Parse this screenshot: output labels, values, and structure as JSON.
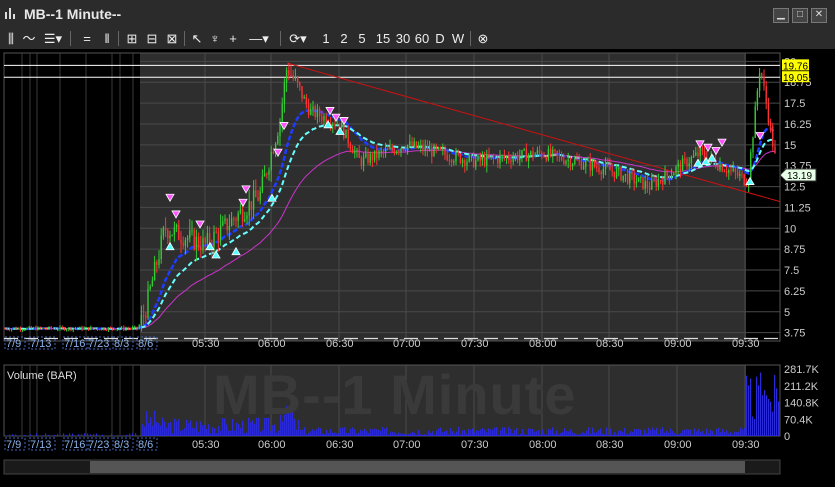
{
  "window": {
    "title": "MB--1 Minute--",
    "minimize": "▁",
    "restore": "□",
    "close": "✕"
  },
  "toolbar": {
    "intervals": [
      "1",
      "2",
      "5",
      "15",
      "30",
      "60",
      "D",
      "W"
    ]
  },
  "chart": {
    "watermark": "MB--1 Minute",
    "volume_label": "Volume (BAR)",
    "price_badges": {
      "upper_top": "19.76",
      "upper_bottom": "19.05",
      "last": "13.19"
    },
    "colors": {
      "up": "#33cc33",
      "down": "#ff3333",
      "ema_fast": "#1e3cff",
      "ema_slow": "#66ffff",
      "vwap": "#cc33cc",
      "trend": "#cc1111",
      "volume": "#2a2ad8",
      "badge_yellow": "#ffff00",
      "badge_last": "#e8ffe8"
    },
    "dates": [
      "7/9",
      "7/13",
      "7/16",
      "7/23",
      "8/3",
      "8/6"
    ]
  },
  "chart_data": {
    "type": "candlestick",
    "title": "MB--1 Minute",
    "x_ticks": [
      "05:30",
      "06:00",
      "06:30",
      "07:00",
      "07:30",
      "08:00",
      "08:30",
      "09:00",
      "09:30"
    ],
    "y_ticks": [
      3.75,
      5,
      6.25,
      7.5,
      8.75,
      10,
      11.25,
      12.5,
      13.75,
      15,
      16.25,
      17.5,
      18.75,
      20
    ],
    "ylim": [
      3.25,
      20.5
    ],
    "volume_ticks": [
      "0",
      "70.4K",
      "140.8K",
      "211.2K",
      "281.7K"
    ],
    "approx_price_path": [
      {
        "t": "pre-market",
        "price": 4.0
      },
      {
        "t": "05:00",
        "price": 5.0
      },
      {
        "t": "05:10",
        "price": 10.0
      },
      {
        "t": "05:30",
        "price": 9.0
      },
      {
        "t": "05:50",
        "price": 12.0
      },
      {
        "t": "06:00",
        "price": 16.5
      },
      {
        "t": "06:05",
        "price": 19.7
      },
      {
        "t": "06:15",
        "price": 17.0
      },
      {
        "t": "06:30",
        "price": 16.3
      },
      {
        "t": "06:45",
        "price": 14.0
      },
      {
        "t": "07:00",
        "price": 15.0
      },
      {
        "t": "07:30",
        "price": 14.0
      },
      {
        "t": "08:00",
        "price": 14.5
      },
      {
        "t": "08:30",
        "price": 13.5
      },
      {
        "t": "08:50",
        "price": 12.5
      },
      {
        "t": "09:10",
        "price": 14.5
      },
      {
        "t": "09:30",
        "price": 12.8
      },
      {
        "t": "09:35",
        "price": 19.76
      },
      {
        "t": "09:40",
        "price": 13.19
      }
    ]
  }
}
